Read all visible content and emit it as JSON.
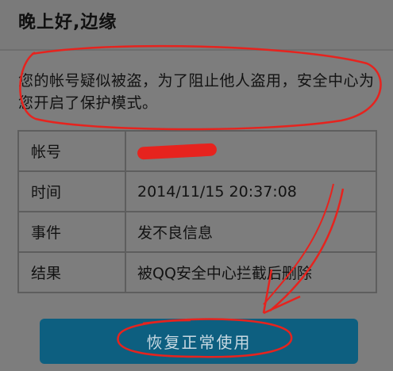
{
  "header": {
    "greeting": "晚上好,边缘"
  },
  "notice": {
    "message": "您的帐号疑似被盗，为了阻止他人盗用，安全中心为您开启了保护模式。"
  },
  "details": {
    "rows": [
      {
        "label": "帐号",
        "value": ""
      },
      {
        "label": "时间",
        "value": "2014/11/15  20:37:08"
      },
      {
        "label": "事件",
        "value": "发不良信息"
      },
      {
        "label": "结果",
        "value": "被QQ安全中心拦截后删除"
      }
    ]
  },
  "actions": {
    "restore_label": "恢复正常使用"
  },
  "colors": {
    "background": "#7d7d7d",
    "button": "#0d5f80",
    "annotation_red": "#e6231e"
  }
}
